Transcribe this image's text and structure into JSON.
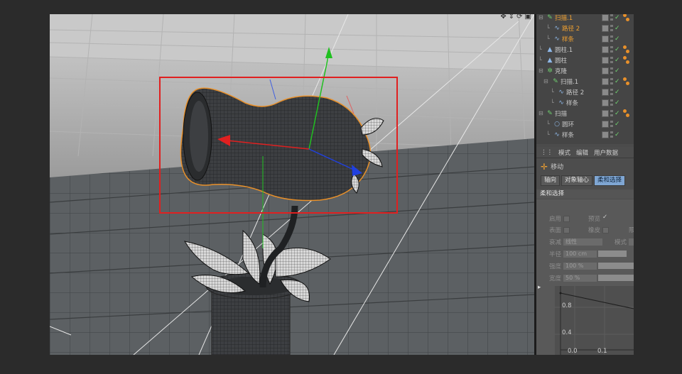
{
  "viewport": {
    "icons": [
      "move-view-icon",
      "zoom-view-icon",
      "rotate-view-icon",
      "maximize-view-icon"
    ],
    "icon_glyphs": [
      "✥",
      "⇕",
      "⟳",
      "▣"
    ],
    "selection_color": "#e02020",
    "axis_colors": {
      "x": "#e02020",
      "y": "#20c020",
      "z": "#2040e0"
    }
  },
  "objects": [
    {
      "name": "扫描.1",
      "orange": true,
      "icon": "sweep-icon"
    },
    {
      "name": "路径 2",
      "orange": true,
      "icon": "spline-icon"
    },
    {
      "name": "样条",
      "orange": true,
      "icon": "spline-icon"
    },
    {
      "name": "圆柱.1",
      "orange": false,
      "icon": "cylinder-icon"
    },
    {
      "name": "圆柱",
      "orange": false,
      "icon": "cylinder-icon"
    },
    {
      "name": "克隆",
      "orange": false,
      "icon": "cloner-icon"
    },
    {
      "name": "扫描.1",
      "orange": false,
      "icon": "sweep-icon"
    },
    {
      "name": "路径 2",
      "orange": false,
      "icon": "spline-icon"
    },
    {
      "name": "样条",
      "orange": false,
      "icon": "spline-icon"
    },
    {
      "name": "扫描",
      "orange": false,
      "icon": "sweep-icon"
    },
    {
      "name": "圆环",
      "orange": false,
      "icon": "circle-icon"
    },
    {
      "name": "样条",
      "orange": false,
      "icon": "spline-icon"
    }
  ],
  "attributes": {
    "menu": [
      "模式",
      "编辑",
      "用户数据"
    ],
    "tool_name": "移动",
    "tabs": [
      "轴向",
      "对象轴心",
      "柔和选择"
    ],
    "active_tab": "柔和选择",
    "section_title": "柔和选择",
    "enable_label": "启用",
    "preview_label": "预览",
    "preview_checked": "✓",
    "surface_label": "表面",
    "rubber_label": "橡皮",
    "limit_label": "限",
    "falloff_label": "衰减",
    "falloff_value": "线性",
    "mode_label": "模式",
    "radius_label": "半径",
    "radius_value": "100 cm",
    "strength_label": "强度",
    "strength_value": "100 %",
    "width_label": "宽度",
    "width_value": "50 %",
    "graph_y_labels": [
      "0.8",
      "0.4"
    ],
    "graph_x_labels": [
      "0.0",
      "0.1"
    ]
  }
}
